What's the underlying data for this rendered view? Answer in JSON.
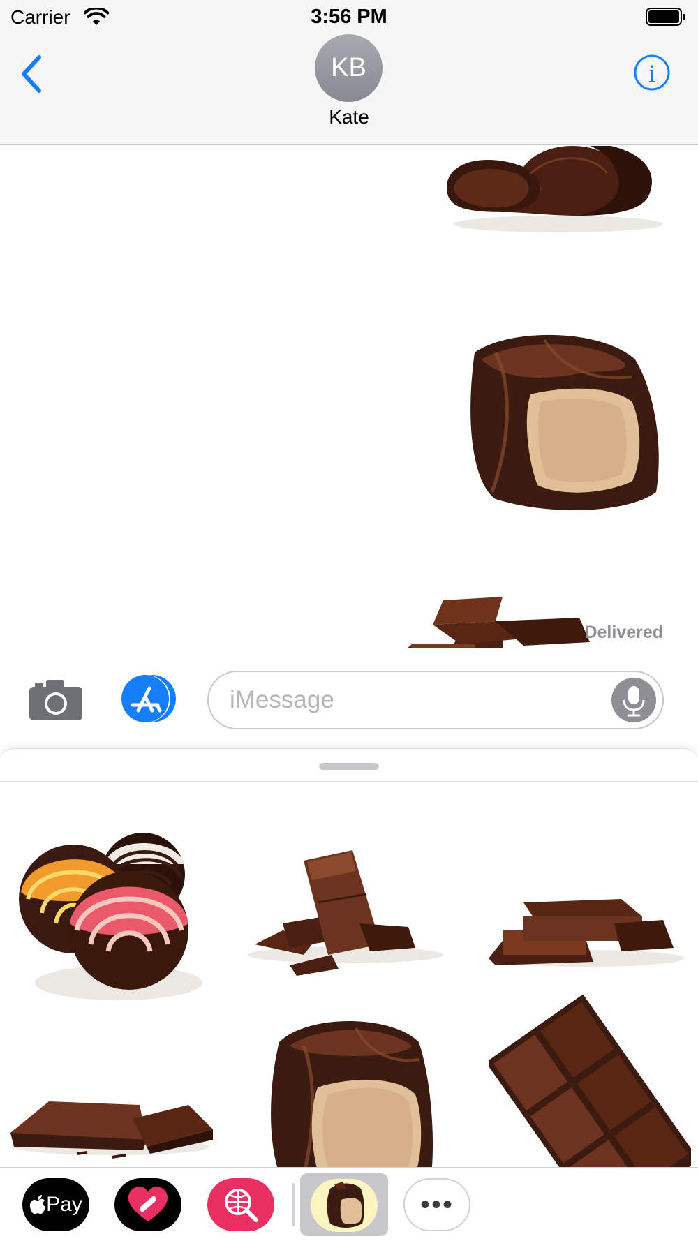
{
  "status_bar": {
    "carrier": "Carrier",
    "time": "3:56 PM"
  },
  "header": {
    "avatar_initials": "KB",
    "contact_name": "Kate"
  },
  "conversation": {
    "messages": [
      {
        "type": "sticker",
        "icon": "chocolate-curl-sticker"
      },
      {
        "type": "sticker",
        "icon": "chocolate-truffle-with-bars-sticker"
      }
    ],
    "status": "Delivered"
  },
  "input_bar": {
    "placeholder": "iMessage",
    "value": ""
  },
  "sticker_drawer": {
    "stickers": [
      {
        "icon": "candy-balls-sticker"
      },
      {
        "icon": "chocolate-pieces-sticker"
      },
      {
        "icon": "stacked-chocolate-sticker"
      },
      {
        "icon": "chocolate-squares-sticker"
      },
      {
        "icon": "chocolate-truffle-sticker"
      },
      {
        "icon": "chocolate-bar-sticker"
      }
    ]
  },
  "app_tray": {
    "apple_pay_label": "Pay",
    "more_label": "•••"
  },
  "colors": {
    "accent": "#157efb",
    "chocolate_dark": "#3b1a10",
    "chocolate_mid": "#6b3320",
    "filling": "#e1bf98",
    "search_app": "#ea2f63"
  }
}
